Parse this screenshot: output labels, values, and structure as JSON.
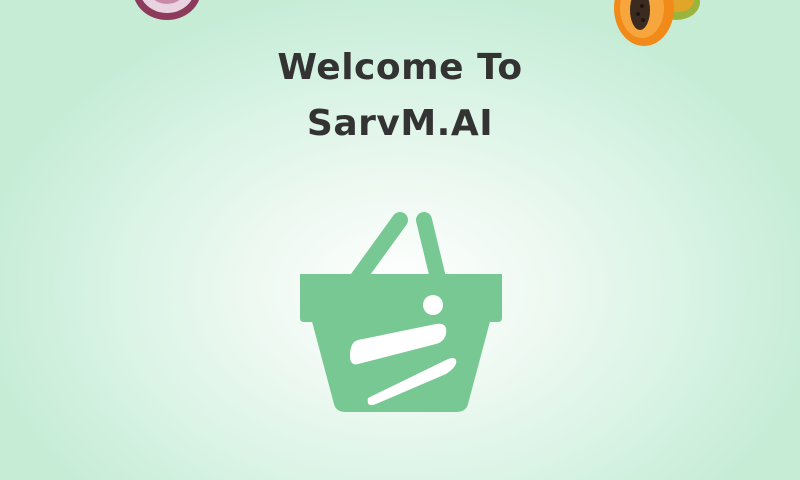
{
  "welcome": {
    "line1": "Welcome To",
    "line2": "SarvM.AI"
  },
  "icons": {
    "logo": "basket-logo-icon",
    "left_decoration": "red-onion-icon",
    "right_decoration": "papaya-icon"
  },
  "colors": {
    "brand_green": "#77c893",
    "title_text": "#333333"
  }
}
